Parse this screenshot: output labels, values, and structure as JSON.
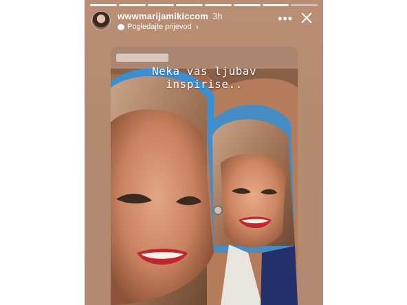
{
  "story": {
    "username": "wwwmarijamikiccom",
    "time": "3h",
    "translate_label": "Pogledajte prijevod",
    "caption": "Neka vas ljubav inspirise..",
    "progress": {
      "segments": 8,
      "current": 8
    }
  },
  "icons": {
    "more": "more-icon",
    "close": "close-icon",
    "translate": "speech-bubble-icon",
    "chevron": "chevron-right-icon"
  },
  "colors": {
    "story_background": "#b48a71",
    "tattoo_blue": "#3a8fd0",
    "lips": "#c0272d"
  }
}
